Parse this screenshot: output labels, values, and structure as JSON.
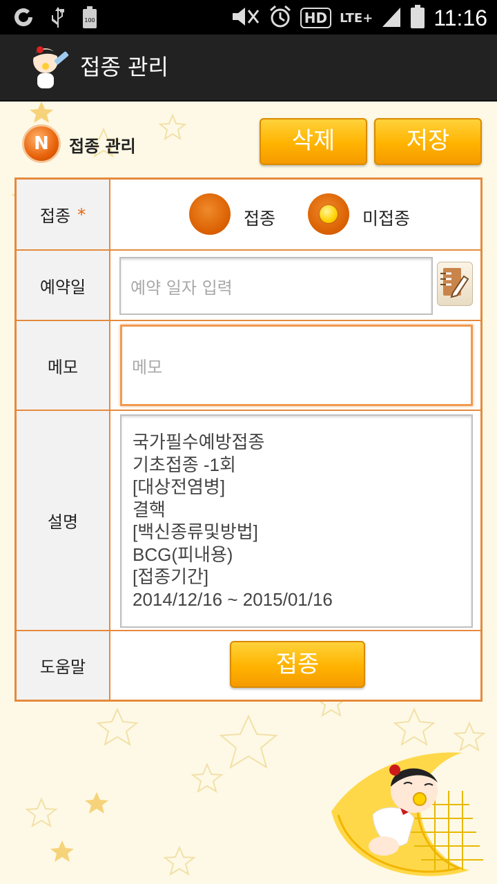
{
  "status_bar": {
    "time": "11:16",
    "battery_level": "100",
    "left_icons": [
      "g-icon",
      "usb-icon",
      "battery-icon"
    ],
    "right_icons": [
      "mute-icon",
      "alarm-icon",
      "hd-icon",
      "lte-icon",
      "signal-icon",
      "battery-icon"
    ],
    "hd_label": "HD",
    "lte_label": "LTE+"
  },
  "action_bar": {
    "title": "접종 관리",
    "logo_icon": "baby-syringe-logo"
  },
  "header": {
    "badge_letter": "N",
    "title": "접종 관리",
    "delete_label": "삭제",
    "save_label": "저장"
  },
  "form": {
    "vaccination": {
      "label": "접종",
      "required_mark": "*",
      "options": [
        {
          "label": "접종",
          "selected": false
        },
        {
          "label": "미접종",
          "selected": true
        }
      ]
    },
    "reservation": {
      "label": "예약일",
      "placeholder": "예약 일자 입력",
      "value": "",
      "calendar_icon": "calendar-edit-icon"
    },
    "memo": {
      "label": "메모",
      "placeholder": "메모",
      "value": ""
    },
    "description": {
      "label": "설명",
      "lines": [
        "국가필수예방접종",
        "기초접종 -1회",
        "[대상전염병]",
        "결핵",
        "[백신종류및방법]",
        "BCG(피내용)",
        "[접종기간]",
        "2014/12/16 ~ 2015/01/16"
      ]
    },
    "help": {
      "label": "도움말",
      "button_label": "접종"
    }
  },
  "colors": {
    "accent_orange": "#e58a3c",
    "button_yellow": "#ffb300",
    "background": "#fdf9e6",
    "actionbar": "#222222"
  }
}
